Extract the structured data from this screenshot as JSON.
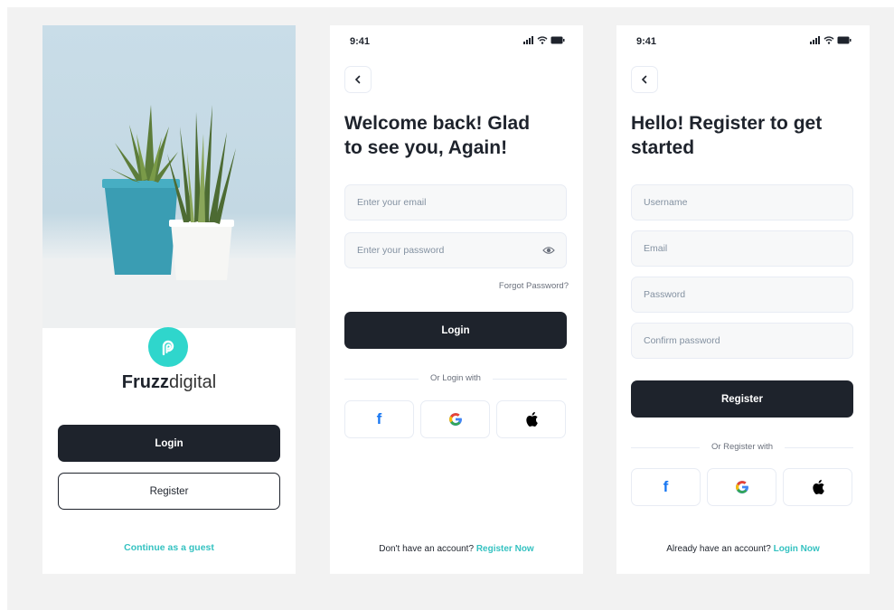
{
  "welcome": {
    "brand_bold": "Fruzz",
    "brand_light": "digital",
    "login_label": "Login",
    "register_label": "Register",
    "guest_label": "Continue as a guest"
  },
  "login": {
    "time": "9:41",
    "heading_line1": "Welcome back! Glad",
    "heading_line2": "to see you, Again!",
    "email_placeholder": "Enter your email",
    "password_placeholder": "Enter your password",
    "forgot_label": "Forgot Password?",
    "login_label": "Login",
    "divider_label": "Or Login with",
    "footer_prefix": "Don't have an account?",
    "footer_link": "Register Now"
  },
  "register": {
    "time": "9:41",
    "heading_line1": "Hello! Register to get",
    "heading_line2": "started",
    "username_placeholder": "Username",
    "email_placeholder": "Email",
    "password_placeholder": "Password",
    "confirm_placeholder": "Confirm password",
    "register_label": "Register",
    "divider_label": "Or Register with",
    "footer_prefix": "Already have an account?",
    "footer_link": "Login Now"
  },
  "colors": {
    "accent": "#35c2c1",
    "dark": "#1e232c",
    "field_bg": "#f7f8f9",
    "facebook": "#1877f2"
  },
  "icons": {
    "logo": "fruzz-logo-icon",
    "back": "chevron-left-icon",
    "eye": "eye-icon",
    "facebook": "facebook-icon",
    "google": "google-icon",
    "apple": "apple-icon",
    "signal": "signal-icon",
    "wifi": "wifi-icon",
    "battery": "battery-icon"
  }
}
